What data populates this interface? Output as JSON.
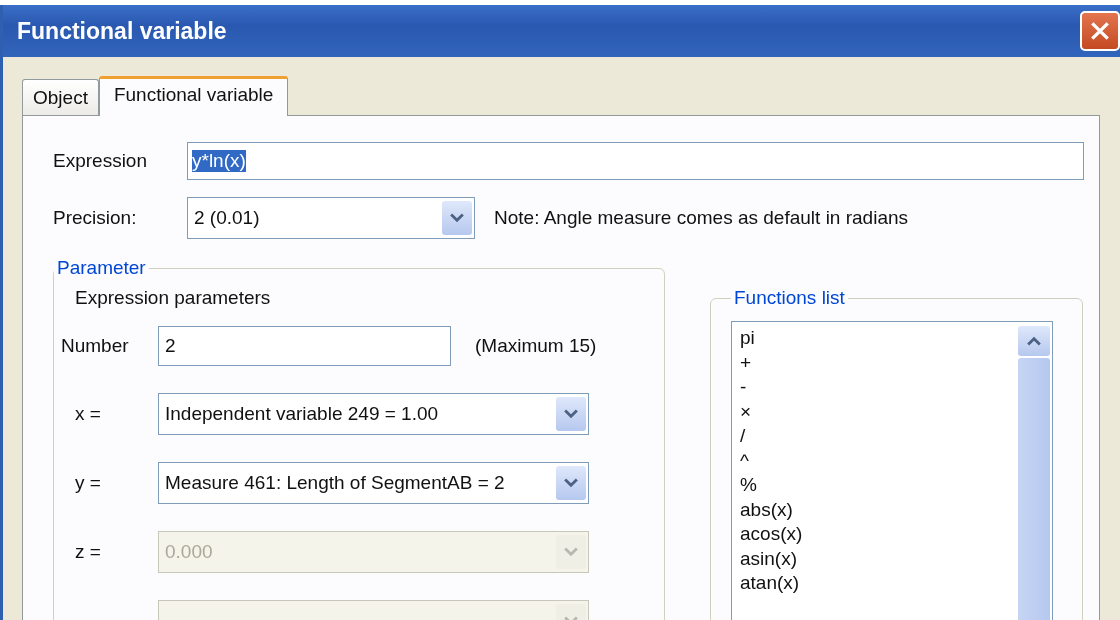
{
  "window": {
    "title": "Functional variable"
  },
  "tabs": [
    {
      "label": "Object",
      "selected": false
    },
    {
      "label": "Functional variable",
      "selected": true
    }
  ],
  "expression": {
    "label": "Expression",
    "value": "y*ln(x)",
    "selected": true
  },
  "precision": {
    "label": "Precision:",
    "value": "2 (0.01)"
  },
  "note": "Note: Angle measure comes as default in radians",
  "parameter_group": {
    "title": "Parameter",
    "caption": "Expression parameters",
    "number": {
      "label": "Number",
      "value": "2",
      "hint": "(Maximum 15)"
    },
    "variables": [
      {
        "label": "x =",
        "value": "Independent variable 249 = 1.00",
        "disabled": false
      },
      {
        "label": "y =",
        "value": "Measure 461: Length of SegmentAB  = 2",
        "disabled": false
      },
      {
        "label": "z =",
        "value": "0.000",
        "disabled": true
      },
      {
        "disabled": true
      }
    ]
  },
  "functions_list": {
    "title": "Functions list",
    "items": [
      "pi",
      "+",
      "-",
      "×",
      "/",
      "^",
      "%",
      "abs(x)",
      "acos(x)",
      "asin(x)",
      "atan(x)"
    ]
  }
}
